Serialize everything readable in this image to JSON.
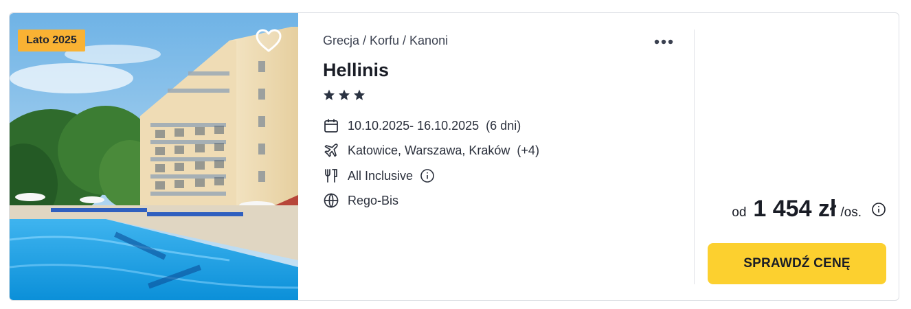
{
  "badge": {
    "label": "Lato 2025",
    "color": "#f9b233"
  },
  "hotel": {
    "breadcrumb": "Grecja / Korfu / Kanoni",
    "name": "Hellinis",
    "stars": 3
  },
  "details": {
    "dates": "10.10.2025- 16.10.2025",
    "duration": "(6 dni)",
    "departures": "Katowice, Warszawa, Kraków",
    "departures_more": "(+4)",
    "board": "All Inclusive",
    "operator": "Rego-Bis"
  },
  "price": {
    "prefix": "od",
    "amount": "1 454 zł",
    "suffix": "/os."
  },
  "cta": {
    "label": "SPRAWDŹ CENĘ",
    "color": "#fcd02f"
  },
  "icons": {
    "favorite": "heart-icon",
    "more": "more-dots-icon",
    "dates": "calendar-icon",
    "departures": "plane-icon",
    "board": "cutlery-icon",
    "operator": "globe-icon",
    "info": "info-icon",
    "star": "star-icon"
  }
}
